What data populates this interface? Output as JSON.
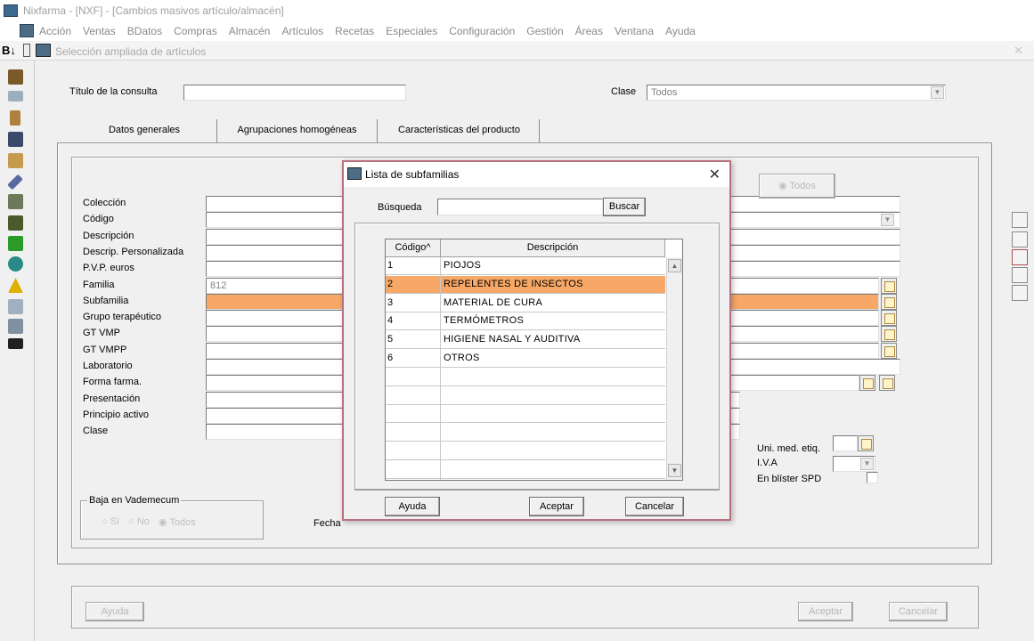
{
  "app": {
    "title": "Nixfarma - [NXF] - [Cambios masivos artículo/almacén]",
    "menu": [
      "Acción",
      "Ventas",
      "BDatos",
      "Compras",
      "Almacén",
      "Artículos",
      "Recetas",
      "Especiales",
      "Configuración",
      "Gestión",
      "Áreas",
      "Ventana",
      "Ayuda"
    ],
    "child_title": "Selección ampliada de artículos",
    "child_prefix": "B↓"
  },
  "form": {
    "titulo_label": "Título de la consulta",
    "titulo_value": "",
    "clase_label": "Clase",
    "clase_value": "Todos",
    "tabs": [
      "Datos generales",
      "Agrupaciones homogéneas",
      "Características del producto"
    ],
    "fields": [
      {
        "label": "Colección",
        "value": ""
      },
      {
        "label": "Código",
        "value": ""
      },
      {
        "label": "Descripción",
        "value": ""
      },
      {
        "label": "Descrip. Personalizada",
        "value": ""
      },
      {
        "label": "P.V.P. euros",
        "value": ""
      },
      {
        "label": "Familia",
        "value": "812"
      },
      {
        "label": "Subfamilia",
        "value": ""
      },
      {
        "label": "Grupo terapéutico",
        "value": ""
      },
      {
        "label": "GT VMP",
        "value": ""
      },
      {
        "label": "GT VMPP",
        "value": ""
      },
      {
        "label": "Laboratorio",
        "value": ""
      },
      {
        "label": "Forma farma.",
        "value": ""
      },
      {
        "label": "Presentación",
        "value": ""
      },
      {
        "label": "Principio activo",
        "value": ""
      },
      {
        "label": "Clase",
        "value": ""
      }
    ],
    "todos_label": "Todos",
    "uni_med_label": "Uni. med. etiq.",
    "iva_label": "I.V.A",
    "blister_label": "En blíster SPD",
    "baja_group_label": "Baja en Vademecum",
    "baja_options": [
      "Sí",
      "No",
      "Todos"
    ],
    "fecha_label": "Fecha",
    "ayuda_label": "Ayuda",
    "aceptar_label": "Aceptar",
    "cancelar_label": "Cancelar"
  },
  "dialog": {
    "title": "Lista de subfamilias",
    "close_icon": "close-icon",
    "search_label": "Búsqueda",
    "search_value": "",
    "search_button": "Buscar",
    "columns": [
      "Código^",
      "Descripción"
    ],
    "rows": [
      {
        "code": "1",
        "desc": "PIOJOS"
      },
      {
        "code": "2",
        "desc": "REPELENTES DE INSECTOS"
      },
      {
        "code": "3",
        "desc": "MATERIAL DE CURA"
      },
      {
        "code": "4",
        "desc": "TERMÓMETROS"
      },
      {
        "code": "5",
        "desc": "HIGIENE NASAL Y AUDITIVA"
      },
      {
        "code": "6",
        "desc": "OTROS"
      }
    ],
    "selected_row": 1,
    "ayuda_label": "Ayuda",
    "aceptar_label": "Aceptar",
    "cancelar_label": "Cancelar"
  },
  "colors": {
    "highlight": "#f7a866",
    "dialog_border": "#b8707e"
  }
}
